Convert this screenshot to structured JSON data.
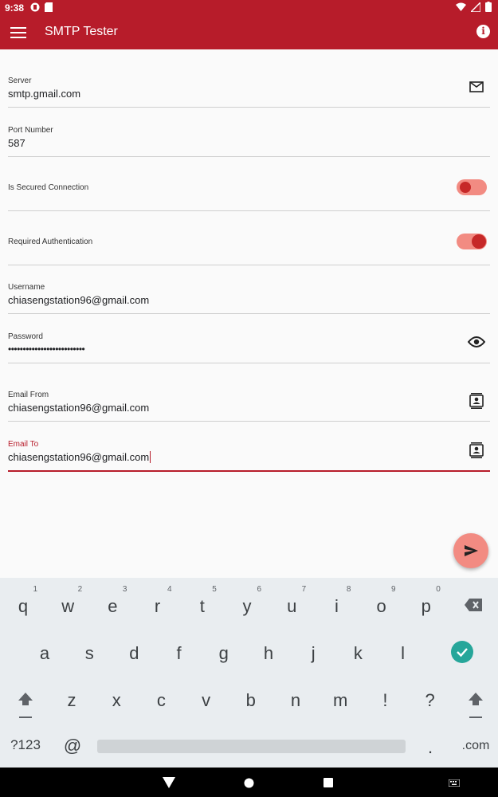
{
  "status_bar": {
    "time": "9:38"
  },
  "app_bar": {
    "title": "SMTP Tester",
    "menu_icon": "menu-icon",
    "info_icon": "info-icon"
  },
  "form": {
    "server": {
      "label": "Server",
      "value": "smtp.gmail.com"
    },
    "port": {
      "label": "Port Number",
      "value": "587"
    },
    "secured": {
      "label": "Is Secured Connection",
      "on": false
    },
    "auth": {
      "label": "Required Authentication",
      "on": true
    },
    "username": {
      "label": "Username",
      "value": "chiasengstation96@gmail.com"
    },
    "password": {
      "label": "Password",
      "value": "••••••••••••••••••••••••••"
    },
    "email_from": {
      "label": "Email From",
      "value": "chiasengstation96@gmail.com"
    },
    "email_to": {
      "label": "Email To",
      "value": "chiasengstation96@gmail.com"
    }
  },
  "colors": {
    "primary": "#b71c2a",
    "accent": "#f28b82",
    "knob": "#c62828"
  },
  "keyboard": {
    "row1": [
      "q",
      "w",
      "e",
      "r",
      "t",
      "y",
      "u",
      "i",
      "o",
      "p"
    ],
    "row1_hints": [
      "1",
      "2",
      "3",
      "4",
      "5",
      "6",
      "7",
      "8",
      "9",
      "0"
    ],
    "row2": [
      "a",
      "s",
      "d",
      "f",
      "g",
      "h",
      "j",
      "k",
      "l"
    ],
    "row3": [
      "z",
      "x",
      "c",
      "v",
      "b",
      "n",
      "m",
      "!",
      "?"
    ],
    "bottom": {
      "symbols": "?123",
      "at": "@",
      "period": ".",
      "dotcom": ".com"
    }
  }
}
